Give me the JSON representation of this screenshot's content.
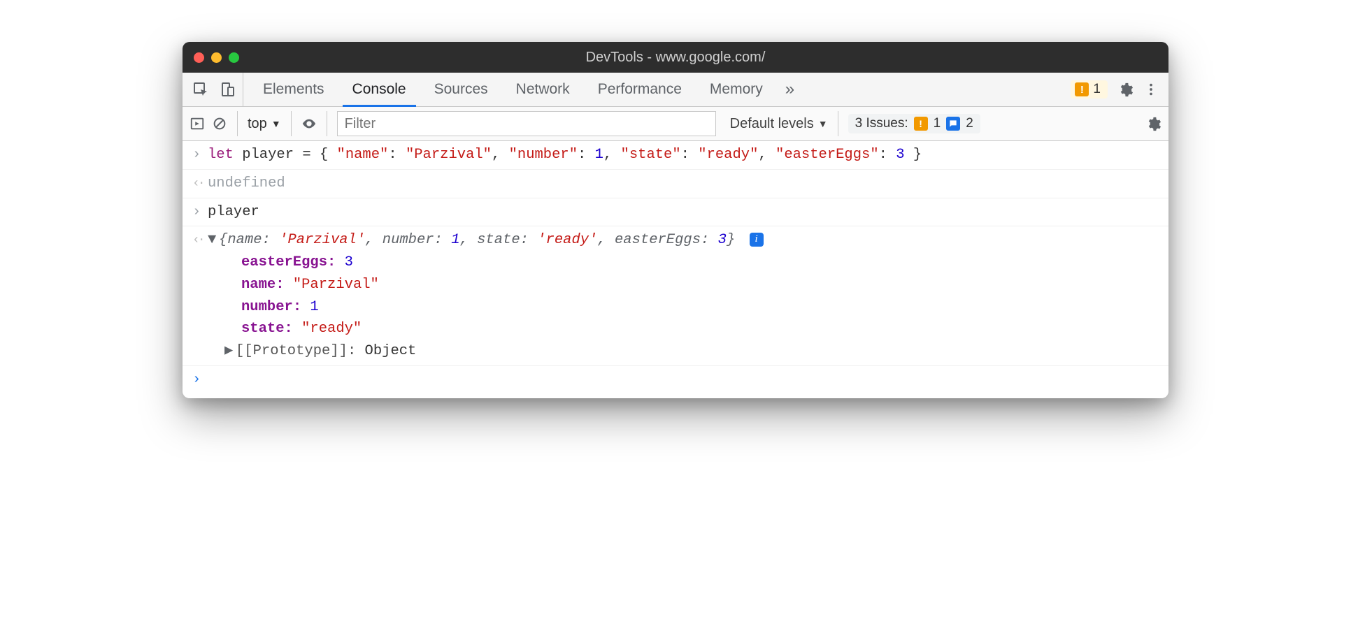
{
  "window": {
    "title": "DevTools - www.google.com/"
  },
  "tabs": {
    "items": [
      "Elements",
      "Console",
      "Sources",
      "Network",
      "Performance",
      "Memory"
    ],
    "active_index": 1,
    "overflow_glyph": "»",
    "warn_count": "1"
  },
  "toolbar": {
    "context": "top",
    "filter_placeholder": "Filter",
    "levels_label": "Default levels",
    "issues_label": "3 Issues:",
    "issues_warn": "1",
    "issues_info": "2"
  },
  "console": {
    "input1_prefix": "let",
    "input1_var": " player = { ",
    "input1_pairs": [
      {
        "k": "\"name\"",
        "v": "\"Parzival\"",
        "t": "str"
      },
      {
        "k": "\"number\"",
        "v": "1",
        "t": "num"
      },
      {
        "k": "\"state\"",
        "v": "\"ready\"",
        "t": "str"
      },
      {
        "k": "\"easterEggs\"",
        "v": "3",
        "t": "num"
      }
    ],
    "input1_suffix": " }",
    "output1": "undefined",
    "input2": "player",
    "expanded": {
      "summary_pairs": [
        {
          "k": "name",
          "v": "'Parzival'",
          "t": "str"
        },
        {
          "k": "number",
          "v": "1",
          "t": "num"
        },
        {
          "k": "state",
          "v": "'ready'",
          "t": "str"
        },
        {
          "k": "easterEggs",
          "v": "3",
          "t": "num"
        }
      ],
      "props": [
        {
          "k": "easterEggs",
          "v": "3",
          "t": "num"
        },
        {
          "k": "name",
          "v": "\"Parzival\"",
          "t": "str"
        },
        {
          "k": "number",
          "v": "1",
          "t": "num"
        },
        {
          "k": "state",
          "v": "\"ready\"",
          "t": "str"
        }
      ],
      "proto_label": "[[Prototype]]",
      "proto_value": "Object"
    }
  }
}
